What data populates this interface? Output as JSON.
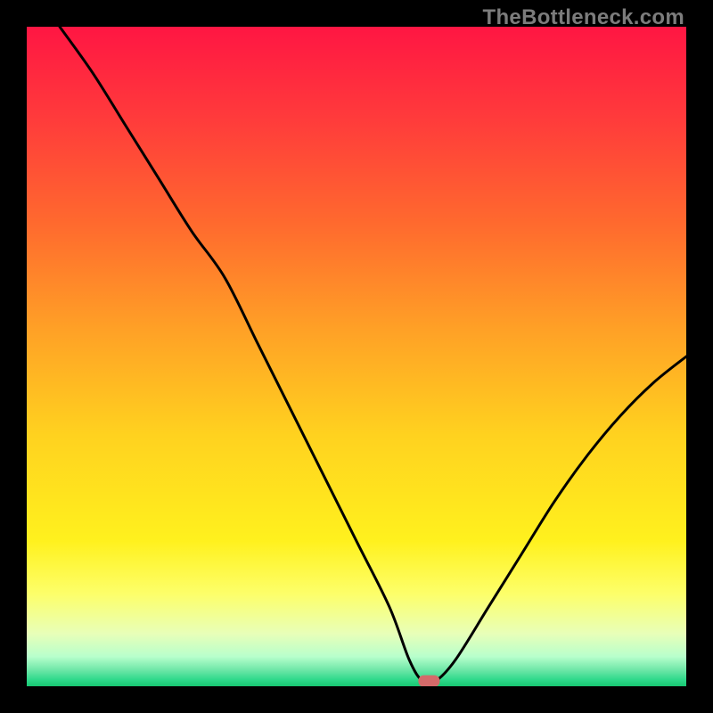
{
  "watermark": "TheBottleneck.com",
  "chart_data": {
    "type": "line",
    "title": "",
    "xlabel": "",
    "ylabel": "",
    "xlim": [
      0,
      100
    ],
    "ylim": [
      0,
      100
    ],
    "grid": false,
    "legend": false,
    "series": [
      {
        "name": "curve",
        "x": [
          5,
          10,
          15,
          20,
          25,
          30,
          35,
          40,
          45,
          50,
          55,
          58,
          60,
          62,
          65,
          70,
          75,
          80,
          85,
          90,
          95,
          100
        ],
        "y": [
          100,
          93,
          85,
          77,
          69,
          62,
          52,
          42,
          32,
          22,
          12,
          4,
          0.8,
          0.8,
          4,
          12,
          20,
          28,
          35,
          41,
          46,
          50
        ]
      }
    ],
    "marker": {
      "x": 61,
      "y": 0.8
    },
    "background": {
      "type": "vertical-gradient",
      "stops": [
        {
          "pos": 0.0,
          "color": "#ff1643"
        },
        {
          "pos": 0.14,
          "color": "#ff3b3b"
        },
        {
          "pos": 0.3,
          "color": "#ff6a2e"
        },
        {
          "pos": 0.46,
          "color": "#ffa126"
        },
        {
          "pos": 0.62,
          "color": "#ffd21f"
        },
        {
          "pos": 0.78,
          "color": "#fff11e"
        },
        {
          "pos": 0.86,
          "color": "#fdff6a"
        },
        {
          "pos": 0.92,
          "color": "#e8ffb8"
        },
        {
          "pos": 0.955,
          "color": "#b8ffcc"
        },
        {
          "pos": 0.975,
          "color": "#6fe7a8"
        },
        {
          "pos": 0.99,
          "color": "#2fd98b"
        },
        {
          "pos": 1.0,
          "color": "#17c772"
        }
      ]
    }
  }
}
